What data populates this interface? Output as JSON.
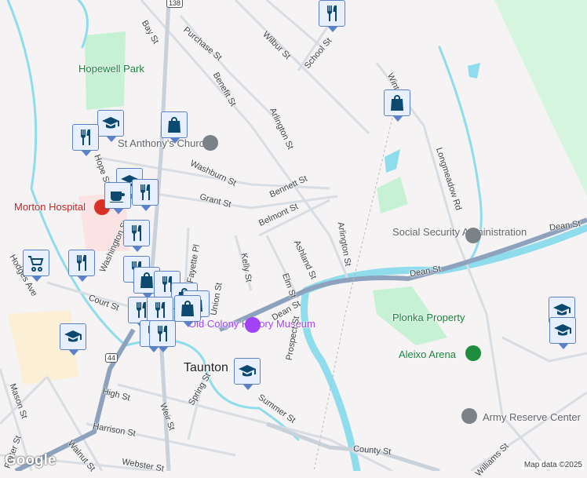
{
  "map": {
    "labels": {
      "bay": "Bay St",
      "purchase": "Purchase St",
      "wilbur": "Wilbur St",
      "school": "School St",
      "hopewell": "Hopewell Park",
      "benefit": "Benefit St",
      "arlington1": "Arlington St",
      "winthrop": "Wint",
      "longmeadow": "Longmeadow Rd",
      "church": "St Anthony's Church",
      "washburn": "Washburn St",
      "bennett": "Bennett St",
      "grant": "Grant St",
      "belmont": "Belmont St",
      "morton": "Morton Hospital",
      "hope": "Hope St",
      "washington": "Washington St",
      "fayette": "Fayette Pl",
      "kelly": "Kelly St",
      "ashland": "Ashland St",
      "arlington2": "Arlington St",
      "ssa": "Social Security Administration",
      "dean1": "Dean St",
      "dean2": "Dean St",
      "dean3": "Dean St",
      "elm": "Elm St",
      "union": "Union St",
      "court": "Court St",
      "hodges": "Hodges Ave",
      "plonka": "Plonka Property",
      "aleixo": "Aleixo Arena",
      "museum": "Old Colony History Museum",
      "prospect": "Prospect St",
      "taunton": "Taunton",
      "weir": "Weir St",
      "spring": "Spring St",
      "summer": "Summer St",
      "high": "High St",
      "harrison": "Harrison St",
      "mason": "Mason St",
      "porter": "Porter St",
      "walnut": "Walnut St",
      "webster": "Webster St",
      "army": "Army Reserve Center",
      "county": "County St",
      "williams": "Williams St"
    },
    "route_shields": [
      "138",
      "44"
    ],
    "attribution": "Map data ©2025",
    "logo": "Google",
    "colors": {
      "water": "#8fdcec",
      "park": "#c6f1d5",
      "highway": "#8ea2bd",
      "road": "#d8dde3",
      "marker_icon": "#0b4a6e"
    }
  }
}
